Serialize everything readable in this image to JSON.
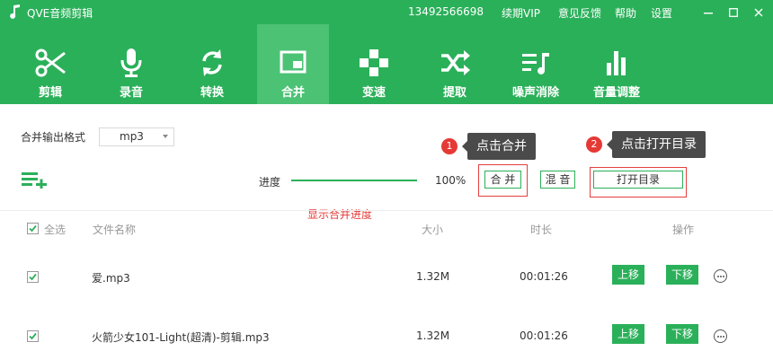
{
  "titlebar": {
    "app_title": "QVE音频剪辑",
    "phone": "13492566698",
    "links": {
      "vip": "续期VIP",
      "feedback": "意见反馈",
      "help": "帮助",
      "settings": "设置"
    }
  },
  "toolbar": {
    "items": [
      {
        "label": "剪辑",
        "icon": "scissors-icon"
      },
      {
        "label": "录音",
        "icon": "microphone-icon"
      },
      {
        "label": "转换",
        "icon": "convert-icon"
      },
      {
        "label": "合并",
        "icon": "merge-icon",
        "active": true
      },
      {
        "label": "变速",
        "icon": "speed-icon"
      },
      {
        "label": "提取",
        "icon": "shuffle-icon"
      },
      {
        "label": "噪声消除",
        "icon": "noise-removal-icon"
      },
      {
        "label": "音量调整",
        "icon": "volume-bars-icon"
      }
    ]
  },
  "format": {
    "label": "合并输出格式",
    "value": "mp3"
  },
  "progress": {
    "label": "进度",
    "percent_text": "100%",
    "value": 100
  },
  "buttons": {
    "merge": "合 并",
    "mix": "混 音",
    "open_dir": "打开目录"
  },
  "annotations": {
    "step1": {
      "number": "1",
      "text": "点击合并"
    },
    "step2": {
      "number": "2",
      "text": "点击打开目录"
    },
    "progress_note": "显示合并进度"
  },
  "table": {
    "select_all": "全选",
    "headers": {
      "name": "文件名称",
      "size": "大小",
      "duration": "时长",
      "actions": "操作"
    },
    "rows": [
      {
        "name": "爱.mp3",
        "size": "1.32M",
        "duration": "00:01:26",
        "up": "上移",
        "down": "下移"
      },
      {
        "name": "火箭少女101-Light(超清)-剪辑.mp3",
        "size": "1.32M",
        "duration": "00:01:26",
        "up": "上移",
        "down": "下移"
      }
    ]
  },
  "colors": {
    "brand": "#2bb05a",
    "active_tab": "#4cc275",
    "highlight": "#e53e3e",
    "tooltip": "#4a4a4a"
  }
}
